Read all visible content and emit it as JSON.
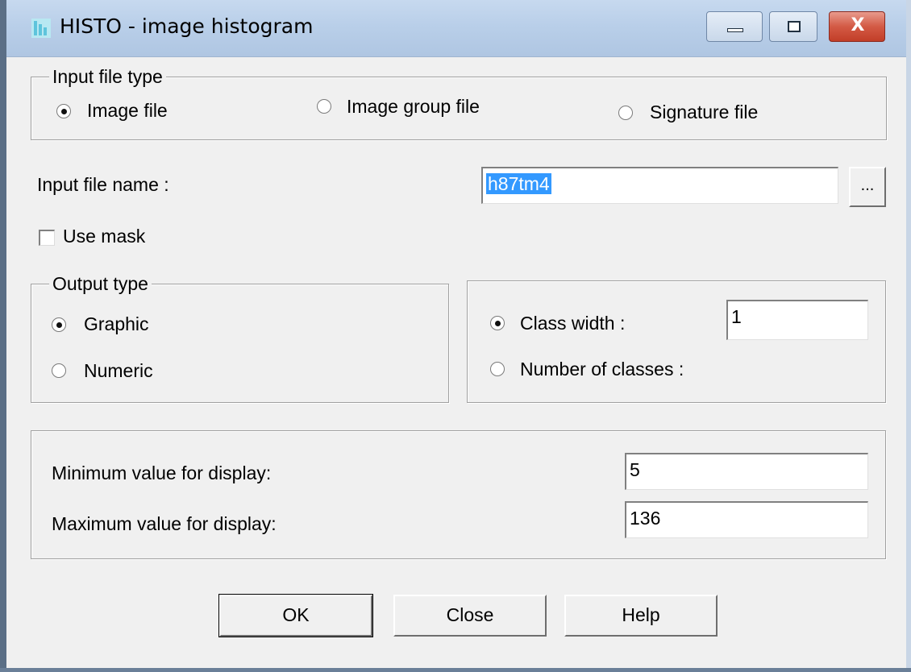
{
  "window": {
    "title": "HISTO - image histogram",
    "close_glyph": "X"
  },
  "input_file_type": {
    "legend": "Input file type",
    "options": [
      {
        "label": "Image file",
        "checked": true
      },
      {
        "label": "Image group file",
        "checked": false
      },
      {
        "label": "Signature file",
        "checked": false
      }
    ]
  },
  "input_file": {
    "label": "Input file name :",
    "value": "h87tm4",
    "browse_label": "..."
  },
  "use_mask": {
    "label": "Use mask",
    "checked": false
  },
  "output_type": {
    "legend": "Output type",
    "options": [
      {
        "label": "Graphic",
        "checked": true
      },
      {
        "label": "Numeric",
        "checked": false
      }
    ]
  },
  "class_options": {
    "options": [
      {
        "label": "Class width :",
        "checked": true
      },
      {
        "label": "Number of classes :",
        "checked": false
      }
    ],
    "class_width_value": "1"
  },
  "display_range": {
    "min_label": "Minimum value for display:",
    "min_value": "5",
    "max_label": "Maximum value for display:",
    "max_value": "136"
  },
  "buttons": {
    "ok": "OK",
    "close": "Close",
    "help": "Help"
  }
}
